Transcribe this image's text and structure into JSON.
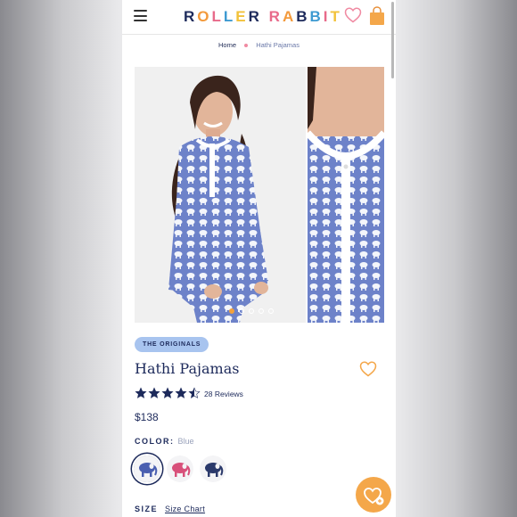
{
  "header": {
    "logo_letters": [
      "R",
      "O",
      "L",
      "L",
      "E",
      "R",
      " ",
      "R",
      "A",
      "B",
      "B",
      "I",
      "T"
    ],
    "logo_colors": [
      "#1d2a5b",
      "#f39a3c",
      "#e86a8a",
      "#3d9ad1",
      "#f2c23a",
      "#1d2a5b",
      "",
      "#e86a8a",
      "#f39a3c",
      "#1d2a5b",
      "#3d9ad1",
      "#e86a8a",
      "#f2c23a"
    ],
    "icons": {
      "menu": "hamburger-icon",
      "wishlist": "heart-icon",
      "bag": "shopping-bag-icon"
    }
  },
  "breadcrumb": {
    "home": "Home",
    "current": "Hathi Pajamas"
  },
  "gallery": {
    "dot_count": 5,
    "active_index": 0
  },
  "product": {
    "badge": "THE ORIGINALS",
    "title": "Hathi Pajamas",
    "rating": 4.5,
    "reviews": "28 Reviews",
    "price": "$138",
    "color_label": "COLOR:",
    "color_value": "Blue",
    "swatches": [
      {
        "name": "Blue",
        "color": "#4a5fb0",
        "selected": true
      },
      {
        "name": "Pink",
        "color": "#d8507a",
        "selected": false
      },
      {
        "name": "Navy",
        "color": "#2b3a6b",
        "selected": false
      }
    ],
    "size_label": "SIZE",
    "size_chart": "Size Chart"
  },
  "colors": {
    "navy": "#1d2a5b",
    "accent_orange": "#f4a74a",
    "badge_blue": "#a8c4ef",
    "pink": "#f08aa2"
  }
}
